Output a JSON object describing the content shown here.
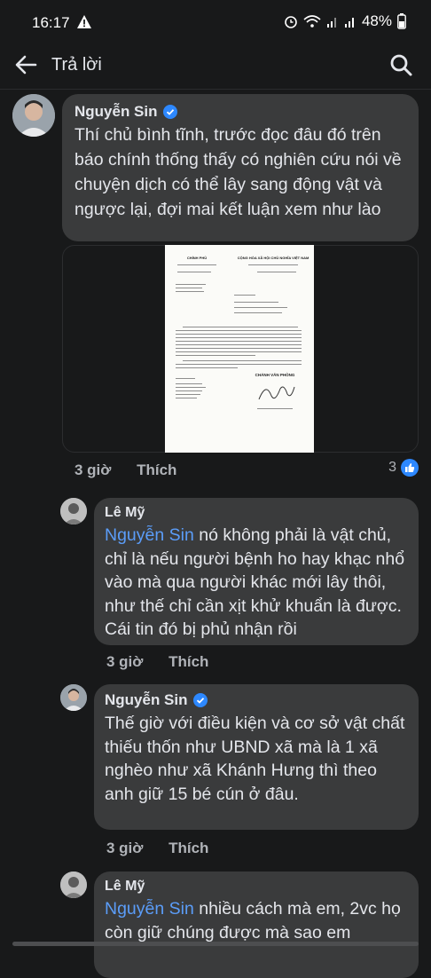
{
  "status": {
    "time": "16:17",
    "battery": "48%"
  },
  "header": {
    "title": "Trả lời"
  },
  "comments": [
    {
      "author": "Nguyễn Sin",
      "verified": true,
      "text": "Thí chủ bình tĩnh, trước đọc đâu đó trên báo chính thống thấy có nghiên cứu nói về chuyện dịch có thể lây sang động vật và ngược lại, đợi mai kết luận xem như lào",
      "time": "3 giờ",
      "like_label": "Thích",
      "reaction_count": "3"
    },
    {
      "author": "Lê Mỹ",
      "mention": "Nguyễn Sin",
      "text": " nó không phải là vật chủ, chỉ là nếu người bệnh ho hay khạc nhổ vào mà qua người khác mới lây thôi, như thế chỉ cần xịt khử khuẩn là được. Cái tin đó bị phủ nhận rồi",
      "time": "3 giờ",
      "like_label": "Thích"
    },
    {
      "author": "Nguyễn Sin",
      "verified": true,
      "text": "Thế giờ với điều kiện và cơ sở vật chất thiếu thốn như UBND xã mà là 1 xã nghèo như xã Khánh Hưng thì theo anh giữ 15 bé cún ở đâu.",
      "time": "3 giờ",
      "like_label": "Thích"
    },
    {
      "author": "Lê Mỹ",
      "mention": "Nguyễn Sin",
      "text": " nhiều cách mà em, 2vc họ còn giữ chúng được mà sao em"
    }
  ],
  "document": {
    "left_header": "CHÍNH PHỦ",
    "right_header": "CỘNG HÒA XÃ HỘI CHỦ NGHĨA VIỆT NAM",
    "signature_title": "CHÁNH VĂN PHÒNG"
  }
}
